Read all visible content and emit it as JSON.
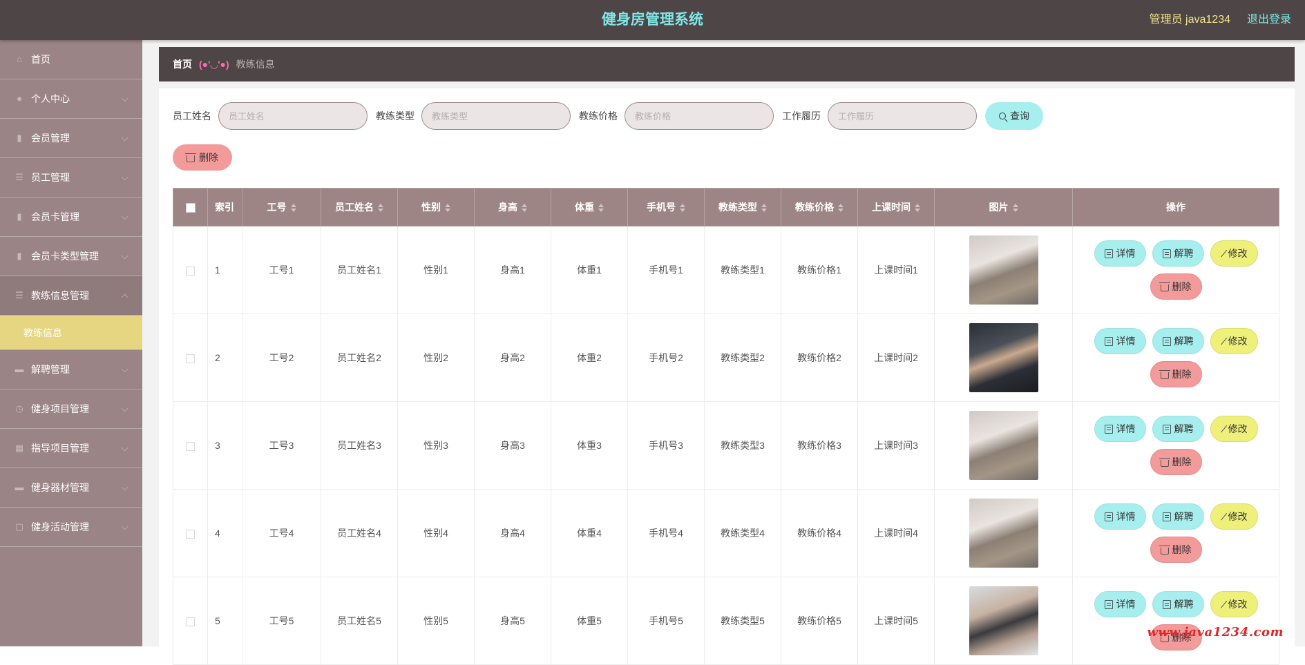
{
  "header": {
    "title": "健身房管理系统",
    "user": "管理员 java1234",
    "logout": "退出登录"
  },
  "sidebar": {
    "items": [
      {
        "label": "首页",
        "icon": "home-icon"
      },
      {
        "label": "个人中心",
        "icon": "user-icon"
      },
      {
        "label": "会员管理",
        "icon": "chart-icon"
      },
      {
        "label": "员工管理",
        "icon": "list-icon"
      },
      {
        "label": "会员卡管理",
        "icon": "chart-icon"
      },
      {
        "label": "会员卡类型管理",
        "icon": "chart-icon"
      },
      {
        "label": "教练信息管理",
        "icon": "list-icon"
      },
      {
        "label": "解聘管理",
        "icon": "briefcase-icon"
      },
      {
        "label": "健身项目管理",
        "icon": "clock-icon"
      },
      {
        "label": "指导项目管理",
        "icon": "grid-icon"
      },
      {
        "label": "健身器材管理",
        "icon": "briefcase-icon"
      },
      {
        "label": "健身活动管理",
        "icon": "doc-icon"
      }
    ],
    "active_sub": "教练信息"
  },
  "breadcrumb": {
    "home": "首页",
    "separator": "(●'◡'●)",
    "current": "教练信息"
  },
  "search": {
    "fields": [
      {
        "label": "员工姓名",
        "placeholder": "员工姓名"
      },
      {
        "label": "教练类型",
        "placeholder": "教练类型"
      },
      {
        "label": "教练价格",
        "placeholder": "教练价格"
      },
      {
        "label": "工作履历",
        "placeholder": "工作履历"
      }
    ],
    "query_label": "查询",
    "delete_label": "删除"
  },
  "table": {
    "columns": [
      "索引",
      "工号",
      "员工姓名",
      "性别",
      "身高",
      "体重",
      "手机号",
      "教练类型",
      "教练价格",
      "上课时间",
      "图片",
      "操作"
    ],
    "rows": [
      {
        "index": "1",
        "no": "工号1",
        "name": "员工姓名1",
        "gender": "性别1",
        "height": "身高1",
        "weight": "体重1",
        "phone": "手机号1",
        "type": "教练类型1",
        "price": "教练价格1",
        "time": "上课时间1"
      },
      {
        "index": "2",
        "no": "工号2",
        "name": "员工姓名2",
        "gender": "性别2",
        "height": "身高2",
        "weight": "体重2",
        "phone": "手机号2",
        "type": "教练类型2",
        "price": "教练价格2",
        "time": "上课时间2"
      },
      {
        "index": "3",
        "no": "工号3",
        "name": "员工姓名3",
        "gender": "性别3",
        "height": "身高3",
        "weight": "体重3",
        "phone": "手机号3",
        "type": "教练类型3",
        "price": "教练价格3",
        "time": "上课时间3"
      },
      {
        "index": "4",
        "no": "工号4",
        "name": "员工姓名4",
        "gender": "性别4",
        "height": "身高4",
        "weight": "体重4",
        "phone": "手机号4",
        "type": "教练类型4",
        "price": "教练价格4",
        "time": "上课时间4"
      },
      {
        "index": "5",
        "no": "工号5",
        "name": "员工姓名5",
        "gender": "性别5",
        "height": "身高5",
        "weight": "体重5",
        "phone": "手机号5",
        "type": "教练类型5",
        "price": "教练价格5",
        "time": "上课时间5"
      }
    ],
    "actions": {
      "detail": "详情",
      "dismiss": "解聘",
      "edit": "修改",
      "delete": "删除"
    }
  },
  "watermark": "www.java1234.com",
  "colors": {
    "header_bg": "#4e4646",
    "sidebar_bg": "#9a8486",
    "active_sub_bg": "#e6d682",
    "accent_cyan": "#a7eeee",
    "accent_yellow": "#eef07a",
    "accent_red": "#f39a9a",
    "table_header_bg": "#9d8586"
  }
}
